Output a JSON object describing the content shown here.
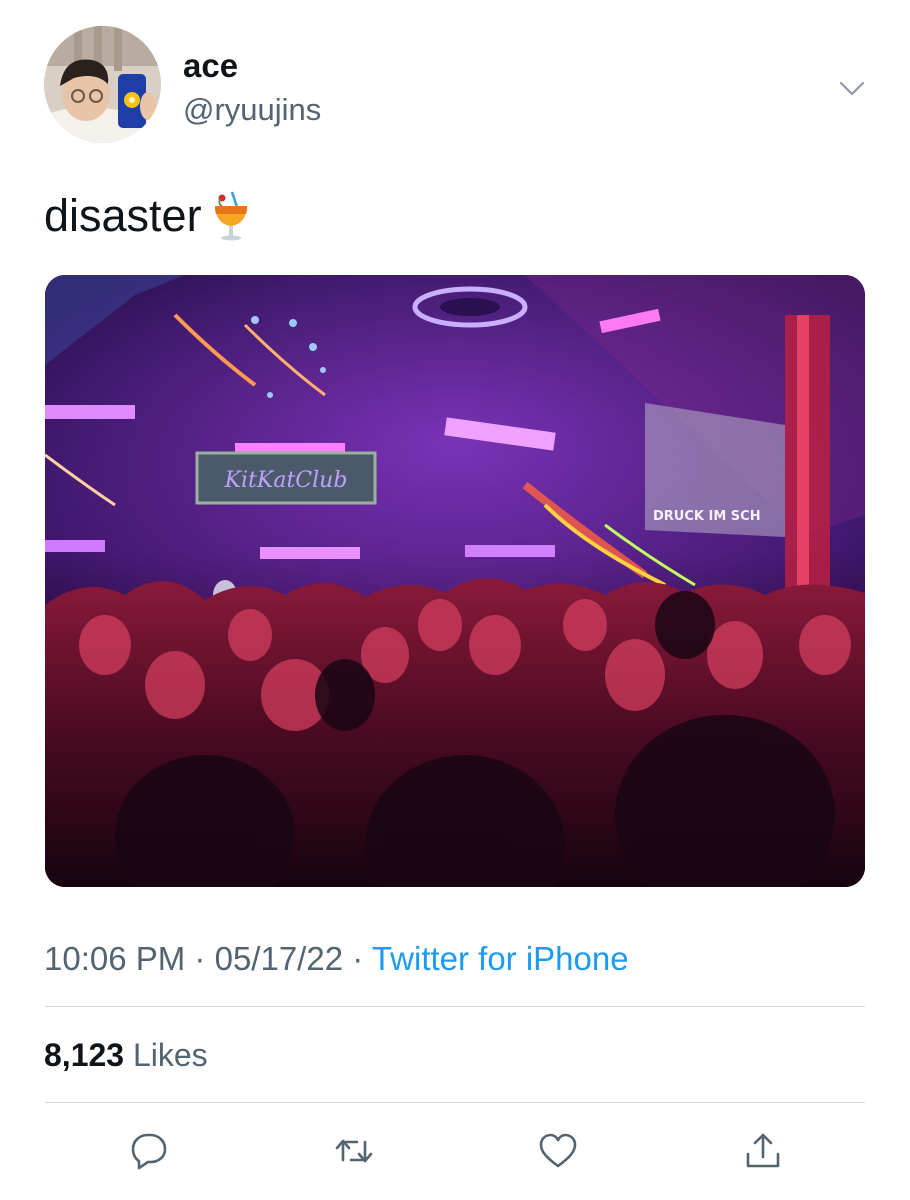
{
  "author": {
    "display_name": "ace",
    "handle": "@ryuujins"
  },
  "tweet": {
    "text": "disaster",
    "emoji": "tropical-drink-emoji",
    "media_signage": [
      "KitKatClub",
      "DRUCK IM SCH"
    ]
  },
  "meta": {
    "time": "10:06 PM",
    "date": "05/17/22",
    "separator": "·",
    "source": "Twitter for iPhone"
  },
  "stats": {
    "likes_count": "8,123",
    "likes_label": "Likes"
  },
  "actions": [
    "reply-icon",
    "retweet-icon",
    "like-icon",
    "share-icon"
  ],
  "colors": {
    "text": "#0f1419",
    "secondary": "#536471",
    "link": "#1d9bf0",
    "divider": "#cfd9de"
  }
}
